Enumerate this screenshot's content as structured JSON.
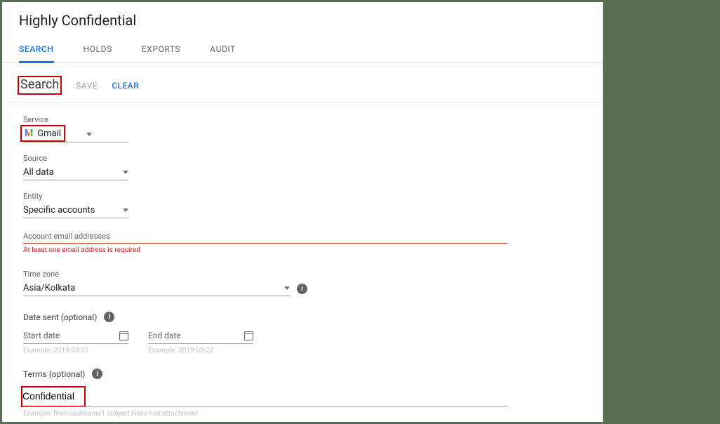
{
  "page": {
    "title": "Highly Confidential"
  },
  "tabs": {
    "search": "SEARCH",
    "holds": "HOLDS",
    "exports": "EXPORTS",
    "audit": "AUDIT"
  },
  "subheader": {
    "title": "Search",
    "save": "SAVE",
    "clear": "CLEAR"
  },
  "service": {
    "label": "Service",
    "value": "Gmail",
    "icon_glyph": "M"
  },
  "source": {
    "label": "Source",
    "value": "All data"
  },
  "entity": {
    "label": "Entity",
    "value": "Specific accounts"
  },
  "email": {
    "label": "Account email addresses",
    "error": "At least one email address is required"
  },
  "timezone": {
    "label": "Time zone",
    "value": "Asia/Kolkata"
  },
  "date_sent": {
    "label": "Date sent (optional)",
    "start_label": "Start date",
    "start_hint": "Example: 2019-03-31",
    "end_label": "End date",
    "end_hint": "Example: 2019-05-22"
  },
  "terms": {
    "label": "Terms (optional)",
    "value": "Confidential",
    "hint": "Example: from:username1 subject:Hello has:attachment"
  }
}
